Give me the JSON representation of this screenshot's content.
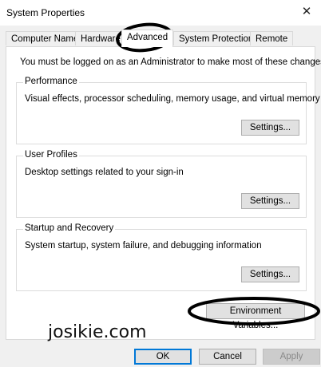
{
  "window": {
    "title": "System Properties",
    "close_glyph": "✕"
  },
  "tabs": [
    {
      "label": "Computer Name"
    },
    {
      "label": "Hardware"
    },
    {
      "label": "Advanced",
      "active": true
    },
    {
      "label": "System Protection"
    },
    {
      "label": "Remote"
    }
  ],
  "panel": {
    "notice": "You must be logged on as an Administrator to make most of these changes.",
    "groups": [
      {
        "title": "Performance",
        "description": "Visual effects, processor scheduling, memory usage, and virtual memory",
        "button": "Settings..."
      },
      {
        "title": "User Profiles",
        "description": "Desktop settings related to your sign-in",
        "button": "Settings..."
      },
      {
        "title": "Startup and Recovery",
        "description": "System startup, system failure, and debugging information",
        "button": "Settings..."
      }
    ],
    "env_button": "Environment Variables..."
  },
  "footer": {
    "ok": "OK",
    "cancel": "Cancel",
    "apply": "Apply"
  },
  "watermark": "josikie.com",
  "colors": {
    "accent": "#0078d7",
    "annotation": "#000000"
  }
}
